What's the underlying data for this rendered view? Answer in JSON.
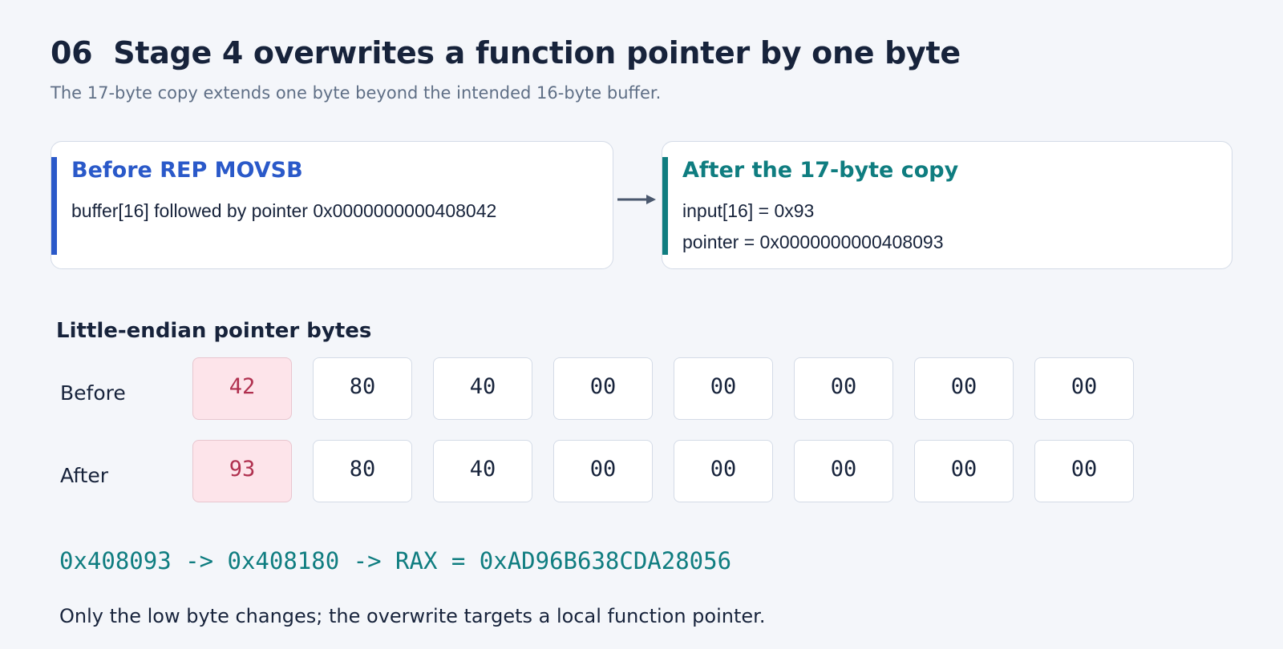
{
  "header": {
    "number": "06",
    "title": "Stage 4 overwrites a function pointer by one byte",
    "subtitle": "The 17-byte copy extends one byte beyond the intended 16-byte buffer."
  },
  "before_card": {
    "title": "Before REP MOVSB",
    "line1": "buffer[16] followed by pointer 0x0000000000408042"
  },
  "after_card": {
    "title": "After the 17-byte copy",
    "line1": "input[16] = 0x93",
    "line2": "pointer = 0x0000000000408093"
  },
  "pointer_bytes": {
    "heading": "Little-endian pointer bytes",
    "before_label": "Before",
    "after_label": "After",
    "before": [
      "42",
      "80",
      "40",
      "00",
      "00",
      "00",
      "00",
      "00"
    ],
    "after": [
      "93",
      "80",
      "40",
      "00",
      "00",
      "00",
      "00",
      "00"
    ],
    "highlight_index": 0
  },
  "chain": "0x408093 -> 0x408180 -> RAX = 0xAD96B638CDA28056",
  "note": "Only the low byte changes; the overwrite targets a local function pointer.",
  "colors": {
    "accent_blue": "#2a59c9",
    "accent_teal": "#0f7d80",
    "highlight_bg": "#fde4ea",
    "highlight_text": "#b0304f"
  }
}
